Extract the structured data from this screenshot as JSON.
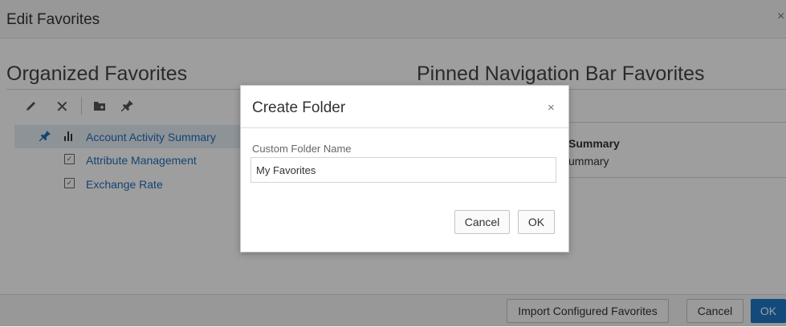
{
  "outer_dialog": {
    "title": "Edit Favorites",
    "close_glyph": "×"
  },
  "left_panel": {
    "title": "Organized Favorites",
    "toolbar": [
      "edit-icon",
      "delete-icon",
      "new-folder-icon",
      "pin-icon"
    ],
    "tree": [
      {
        "label": "Account Activity Summary",
        "icon": "bar-chart-icon",
        "pinned": true,
        "selected": true
      },
      {
        "label": "Attribute Management",
        "icon": "calendar-check-icon",
        "pinned": false,
        "selected": false
      },
      {
        "label": "Exchange Rate",
        "icon": "calendar-check-icon",
        "pinned": false,
        "selected": false
      }
    ]
  },
  "right_panel": {
    "title": "Pinned Navigation Bar Favorites",
    "item_heading": "Summary",
    "item_sub": "ummary"
  },
  "footer": {
    "import_label": "Import Configured Favorites",
    "cancel_label": "Cancel",
    "ok_label": "OK"
  },
  "modal": {
    "title": "Create Folder",
    "close_glyph": "×",
    "field_label": "Custom Folder Name",
    "field_value": "My Favorites",
    "cancel_label": "Cancel",
    "ok_label": "OK"
  },
  "colors": {
    "link": "#1f6fb6",
    "primary": "#1e78c8",
    "overlay": "rgba(0,0,0,0.38)"
  }
}
